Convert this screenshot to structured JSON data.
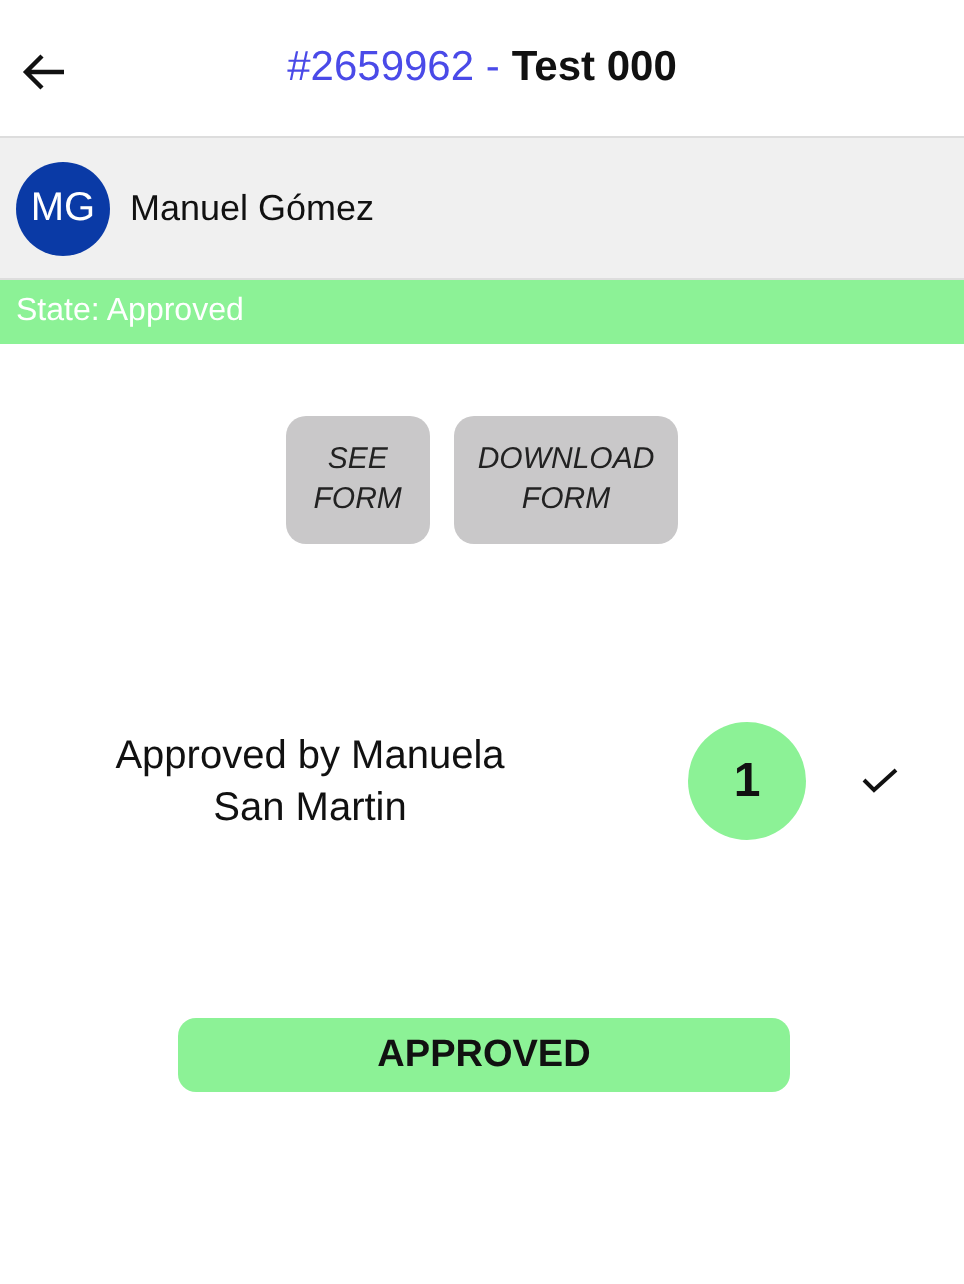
{
  "header": {
    "number": "#2659962 -",
    "title": "Test 000"
  },
  "user": {
    "initials": "MG",
    "name": "Manuel Gómez"
  },
  "state": {
    "label": "State: Approved",
    "approved": true
  },
  "actions": [
    "SEE\nFORM",
    "DOWNLOAD\nFORM"
  ],
  "steps": [
    {
      "label": "Approved by Manuela San Martin",
      "number": "1",
      "approved": true
    }
  ],
  "result": {
    "label": "APPROVED",
    "approved": true
  }
}
